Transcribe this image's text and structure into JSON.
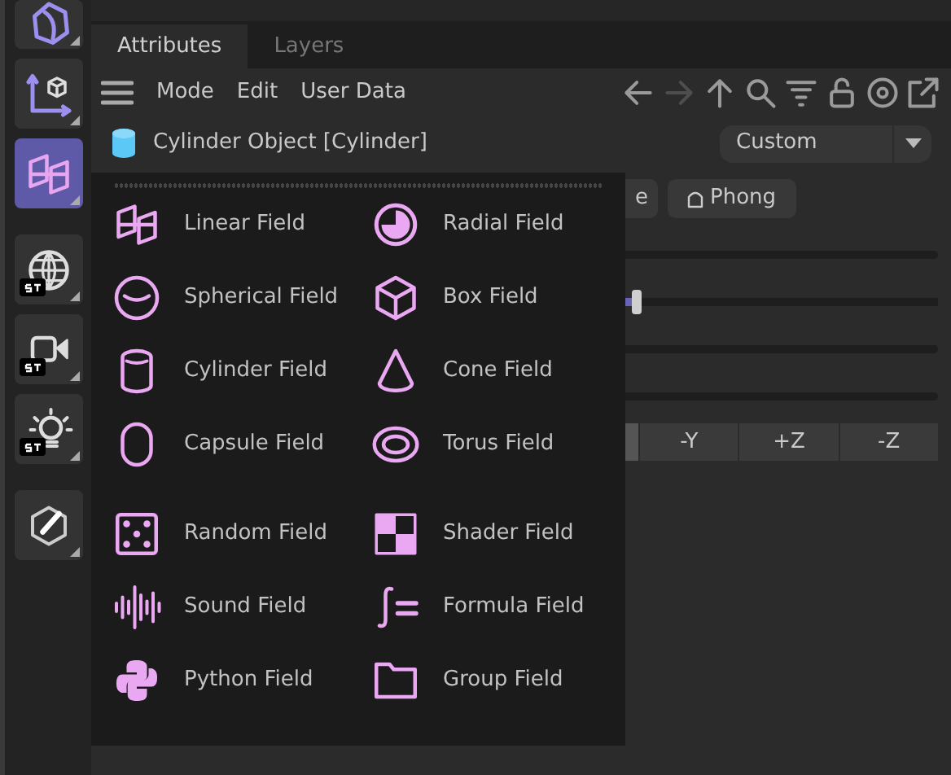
{
  "sidebar": [
    {
      "kind": "sphere-cut",
      "selected": false,
      "st": false
    },
    {
      "kind": "axis",
      "selected": false,
      "st": false
    },
    {
      "kind": "linear",
      "selected": true,
      "st": false
    },
    {
      "kind": "globe",
      "selected": false,
      "st": true
    },
    {
      "kind": "camera",
      "selected": false,
      "st": true
    },
    {
      "kind": "light",
      "selected": false,
      "st": true
    },
    {
      "kind": "pen",
      "selected": false,
      "st": false
    }
  ],
  "tabs": [
    {
      "label": "Attributes",
      "selected": true
    },
    {
      "label": "Layers",
      "selected": false
    }
  ],
  "menu": [
    "Mode",
    "Edit",
    "User Data"
  ],
  "toolbar_buttons": [
    {
      "kind": "back",
      "disabled": false
    },
    {
      "kind": "forward",
      "disabled": true
    },
    {
      "kind": "up",
      "disabled": false
    },
    {
      "kind": "search",
      "disabled": false
    },
    {
      "kind": "filter",
      "disabled": false
    },
    {
      "kind": "lock",
      "disabled": false
    },
    {
      "kind": "target",
      "disabled": false
    },
    {
      "kind": "popout",
      "disabled": false
    }
  ],
  "object": {
    "title": "Cylinder Object [Cylinder]"
  },
  "preset": {
    "value": "Custom"
  },
  "shading_buttons": [
    {
      "label": "e",
      "icon": false
    },
    {
      "label": "Phong",
      "icon": true
    }
  ],
  "sliders": [
    {
      "kind": "track"
    },
    {
      "kind": "slider",
      "level": 0.56
    },
    {
      "kind": "track"
    },
    {
      "kind": "track"
    }
  ],
  "axis_buttons": [
    "-Y",
    "+Z",
    "-Z"
  ],
  "popup": {
    "groups": [
      [
        {
          "kind": "linear",
          "label": "Linear Field"
        },
        {
          "kind": "radial",
          "label": "Radial Field"
        },
        {
          "kind": "sphere",
          "label": "Spherical Field"
        },
        {
          "kind": "box",
          "label": "Box Field"
        },
        {
          "kind": "cylinder",
          "label": "Cylinder Field"
        },
        {
          "kind": "cone",
          "label": "Cone Field"
        },
        {
          "kind": "capsule",
          "label": "Capsule Field"
        },
        {
          "kind": "torus",
          "label": "Torus Field"
        }
      ],
      [
        {
          "kind": "random",
          "label": "Random Field"
        },
        {
          "kind": "shader",
          "label": "Shader Field"
        },
        {
          "kind": "sound",
          "label": "Sound Field"
        },
        {
          "kind": "formula",
          "label": "Formula Field"
        },
        {
          "kind": "python",
          "label": "Python Field"
        },
        {
          "kind": "folder",
          "label": "Group Field"
        }
      ]
    ]
  }
}
